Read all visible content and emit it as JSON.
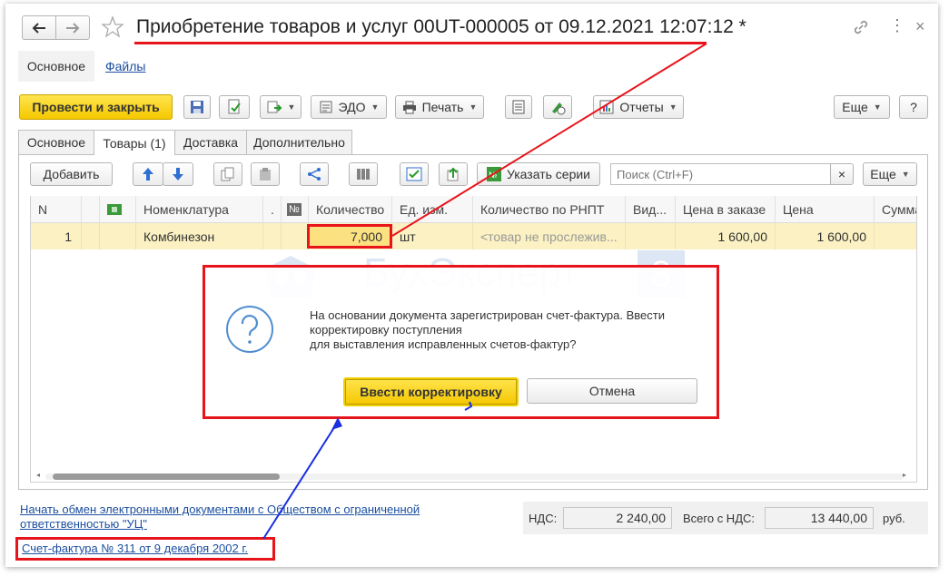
{
  "window": {
    "title": "Приобретение товаров и услуг 00UT-000005 от 09.12.2021 12:07:12 *"
  },
  "nav": {
    "main": "Основное",
    "files": "Файлы"
  },
  "toolbar": {
    "post_close": "Провести и закрыть",
    "edo": "ЭДО",
    "print": "Печать",
    "reports": "Отчеты",
    "more": "Еще",
    "help": "?"
  },
  "tabs": [
    "Основное",
    "Товары (1)",
    "Доставка",
    "Дополнительно"
  ],
  "goods_toolbar": {
    "add": "Добавить",
    "series": "Указать серии",
    "search_placeholder": "Поиск (Ctrl+F)",
    "clear": "×",
    "more": "Еще"
  },
  "table": {
    "headers": {
      "n": "N",
      "nomenclature": "Номенклатура",
      "dot": ".",
      "num_icon": "№",
      "quantity": "Количество",
      "unit": "Ед. изм.",
      "qty_rnpt": "Количество по РНПТ",
      "vid": "Вид...",
      "price_order": "Цена в заказе",
      "price": "Цена",
      "sum": "Сумма"
    },
    "row": {
      "n": "1",
      "nomenclature": "Комбинезон",
      "quantity": "7,000",
      "unit": "шт",
      "qty_rnpt": "<товар не прослежив...",
      "price_order": "1 600,00",
      "price": "1 600,00"
    }
  },
  "watermark": {
    "text": "БухЭксперт",
    "digit": "8"
  },
  "dialog": {
    "line1": "На основании документа зарегистрирован счет-фактура. Ввести",
    "line2": "корректировку поступления",
    "line3": "для выставления исправленных счетов-фактур?",
    "confirm": "Ввести корректировку",
    "cancel": "Отмена"
  },
  "footer": {
    "edo_link_1": "Начать обмен электронными документами с Обществом с ограниченной",
    "edo_link_2": "ответственностью \"УЦ\"",
    "invoice_link": "Счет-фактура № 311 от 9 декабря 2002 г.",
    "vat_label": "НДС:",
    "vat_value": "2 240,00",
    "total_label": "Всего с НДС:",
    "total_value": "13 440,00",
    "currency": "руб."
  },
  "colors": {
    "accent_yellow": "#f5c800",
    "highlight_red": "#e8141b",
    "annotation_blue": "#1a2fe0",
    "link": "#1c4fa0",
    "selected_row": "#fbf1c2"
  }
}
